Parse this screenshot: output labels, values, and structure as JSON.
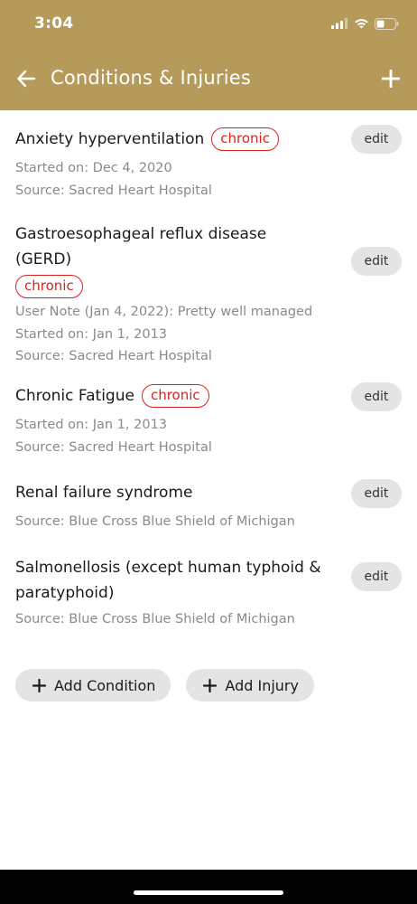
{
  "status_bar": {
    "time": "3:04"
  },
  "header": {
    "title": "Conditions & Injuries"
  },
  "conditions": [
    {
      "title": "Anxiety hyperventilation",
      "badge": "chronic",
      "lines": [
        "Started on: Dec 4, 2020",
        "Source: Sacred Heart Hospital"
      ],
      "edit_label": "edit"
    },
    {
      "title": "Gastroesophageal reflux disease (GERD)",
      "badge": "chronic",
      "lines": [
        "User Note (Jan 4, 2022): Pretty well managed",
        "Started on: Jan 1, 2013",
        "Source: Sacred Heart Hospital"
      ],
      "edit_label": "edit"
    },
    {
      "title": "Chronic Fatigue",
      "badge": "chronic",
      "lines": [
        "Started on: Jan 1, 2013",
        "Source: Sacred Heart Hospital"
      ],
      "edit_label": "edit"
    },
    {
      "title": "Renal failure syndrome",
      "lines": [
        "Source: Blue Cross Blue Shield of Michigan"
      ],
      "edit_label": "edit"
    },
    {
      "title": "Salmonellosis (except human typhoid & paratyphoid)",
      "lines": [
        "Source: Blue Cross Blue Shield of Michigan"
      ],
      "edit_label": "edit"
    }
  ],
  "actions": {
    "add_condition": "Add Condition",
    "add_injury": "Add Injury"
  },
  "colors": {
    "header": "#b69a5a",
    "chip": "#d9241e",
    "button_bg": "#e4e4e4"
  }
}
